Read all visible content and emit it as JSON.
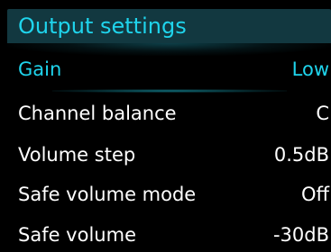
{
  "header": {
    "title": "Output settings"
  },
  "menu": {
    "items": [
      {
        "label": "Gain",
        "value": "Low",
        "selected": true
      },
      {
        "label": "Channel balance",
        "value": "C",
        "selected": false
      },
      {
        "label": "Volume step",
        "value": "0.5dB",
        "selected": false
      },
      {
        "label": "Safe volume mode",
        "value": "Off",
        "selected": false
      },
      {
        "label": "Safe volume",
        "value": "-30dB",
        "selected": false
      }
    ]
  },
  "colors": {
    "accent": "#1fd4ec",
    "header_bg": "#123840",
    "text": "#ffffff",
    "background": "#000000"
  }
}
